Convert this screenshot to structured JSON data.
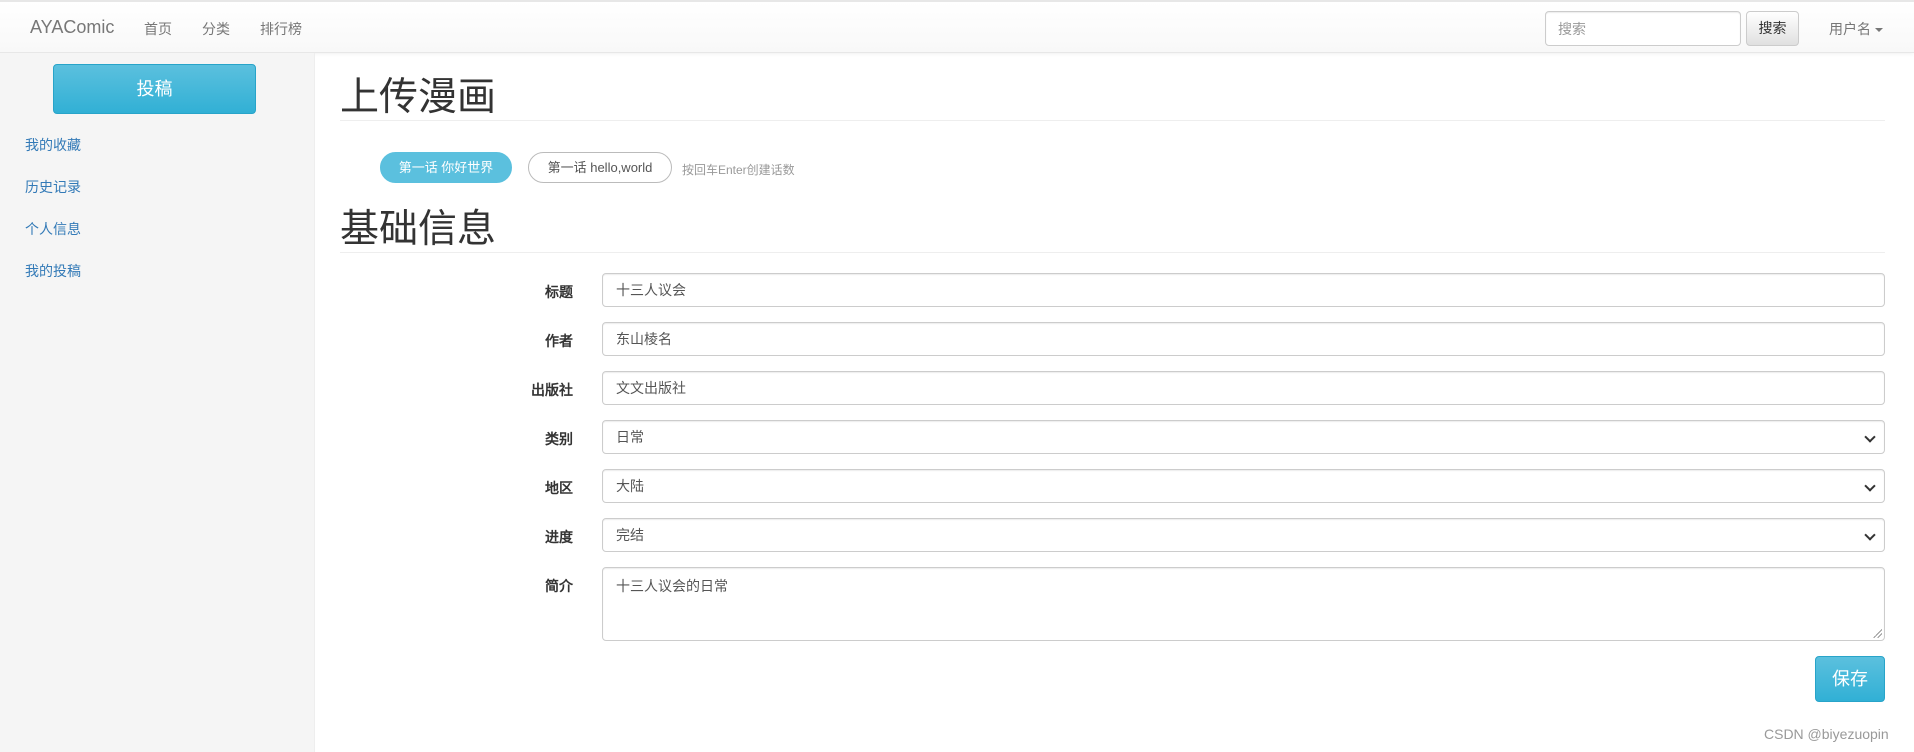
{
  "navbar": {
    "brand": "AYAComic",
    "links": [
      "首页",
      "分类",
      "排行榜"
    ],
    "search_placeholder": "搜索",
    "search_button": "搜索",
    "user_menu": "用户名"
  },
  "sidebar": {
    "submit_button": "投稿",
    "items": [
      "我的收藏",
      "历史记录",
      "个人信息",
      "我的投稿"
    ]
  },
  "main": {
    "upload_title": "上传漫画",
    "chapters": [
      {
        "label": "第一话 你好世界",
        "active": true
      },
      {
        "label": "第一话 hello,world",
        "active": false
      }
    ],
    "chapter_hint": "按回车Enter创建话数",
    "basic_info_title": "基础信息",
    "form": {
      "title_label": "标题",
      "title_value": "十三人议会",
      "author_label": "作者",
      "author_value": "东山棱名",
      "publisher_label": "出版社",
      "publisher_value": "文文出版社",
      "category_label": "类别",
      "category_value": "日常",
      "region_label": "地区",
      "region_value": "大陆",
      "progress_label": "进度",
      "progress_value": "完结",
      "summary_label": "简介",
      "summary_value": "十三人议会的日常"
    },
    "save_button": "保存"
  },
  "watermark": "CSDN @biyezuopin",
  "colors": {
    "accent": "#5bc0de",
    "link": "#337ab7"
  }
}
